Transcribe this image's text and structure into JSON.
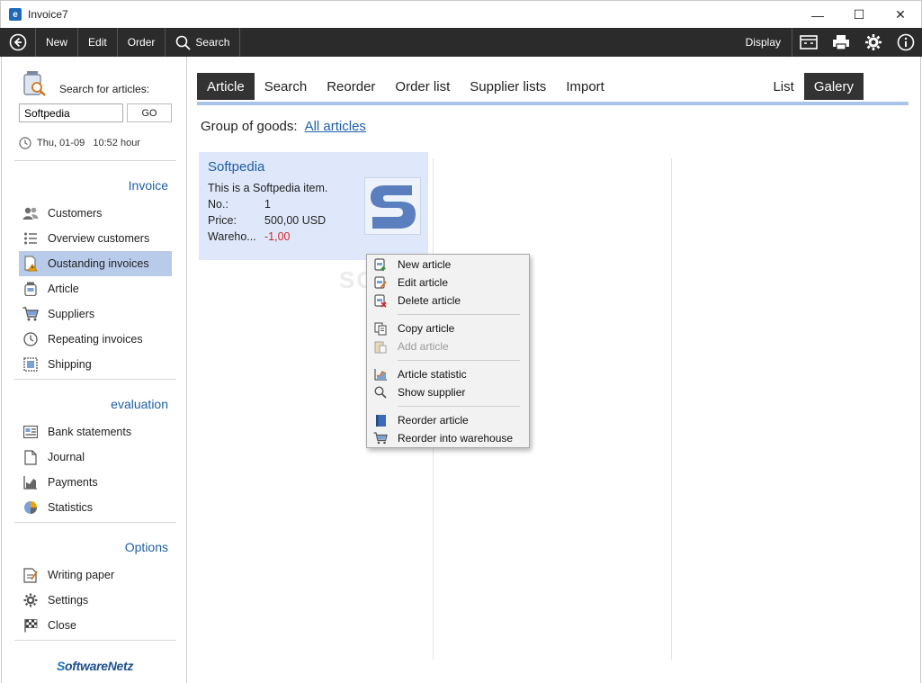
{
  "window": {
    "title": "Invoice7",
    "minimize": "—",
    "maximize": "☐",
    "close": "✕"
  },
  "toolbar": {
    "items": [
      "New",
      "Edit",
      "Order",
      "Search"
    ],
    "display_label": "Display"
  },
  "sidebar": {
    "search_label": "Search for articles:",
    "search_value": "Softpedia",
    "go_label": "GO",
    "datetime": "Thu, 01-09   10:52 hour",
    "sections": [
      {
        "title": "Invoice",
        "items": [
          "Customers",
          "Overview customers",
          "Oustanding invoices",
          "Article",
          "Suppliers",
          "Repeating invoices",
          "Shipping"
        ]
      },
      {
        "title": "evaluation",
        "items": [
          "Bank statements",
          "Journal",
          "Payments",
          "Statistics"
        ]
      },
      {
        "title": "Options",
        "items": [
          "Writing paper",
          "Settings",
          "Close"
        ]
      }
    ],
    "active_item": "Oustanding invoices",
    "brand_a": "S",
    "brand_b": "oftwareNetz"
  },
  "main": {
    "tabs": [
      "Article",
      "Search",
      "Reorder",
      "Order list",
      "Supplier lists",
      "Import"
    ],
    "view_tabs": [
      "List",
      "Galery"
    ],
    "group_label": "Group of goods:",
    "group_link": "All articles",
    "card": {
      "title": "Softpedia",
      "description": "This is a Softpedia item.",
      "rows": [
        {
          "label": "No.:",
          "value": "1"
        },
        {
          "label": "Price:",
          "value": "500,00 USD"
        },
        {
          "label": "Wareho...",
          "value": "-1,00"
        }
      ]
    }
  },
  "context_menu": {
    "items": [
      {
        "label": "New article",
        "enabled": true
      },
      {
        "label": "Edit article",
        "enabled": true
      },
      {
        "label": "Delete article",
        "enabled": true
      },
      {
        "label": "Copy article",
        "enabled": true
      },
      {
        "label": "Add article",
        "enabled": false
      },
      {
        "label": "Article statistic",
        "enabled": true
      },
      {
        "label": "Show supplier",
        "enabled": true
      },
      {
        "label": "Reorder article",
        "enabled": true
      },
      {
        "label": "Reorder into warehouse",
        "enabled": true
      }
    ]
  },
  "watermark": "SOFTPEDIA",
  "colors": {
    "accent": "#1d5fa8",
    "active_bg": "#b9cbea",
    "card_bg": "#dfe8fa",
    "toolbar_bg": "#2b2b2b",
    "negative": "#d42626"
  }
}
